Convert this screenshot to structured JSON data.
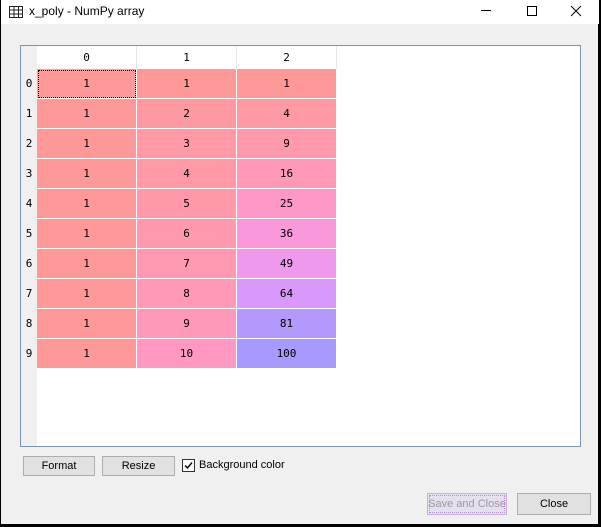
{
  "window": {
    "title": "x_poly - NumPy array"
  },
  "table": {
    "columns": [
      "0",
      "1",
      "2"
    ],
    "rows": [
      "0",
      "1",
      "2",
      "3",
      "4",
      "5",
      "6",
      "7",
      "8",
      "9"
    ],
    "cells": [
      [
        "1",
        "1",
        "1"
      ],
      [
        "1",
        "2",
        "4"
      ],
      [
        "1",
        "3",
        "9"
      ],
      [
        "1",
        "4",
        "16"
      ],
      [
        "1",
        "5",
        "25"
      ],
      [
        "1",
        "6",
        "36"
      ],
      [
        "1",
        "7",
        "49"
      ],
      [
        "1",
        "8",
        "64"
      ],
      [
        "1",
        "9",
        "81"
      ],
      [
        "1",
        "10",
        "100"
      ]
    ],
    "cell_colors": [
      [
        "#ff9999",
        "#ff9999",
        "#ff9999"
      ],
      [
        "#ff9999",
        "#ff99a1",
        "#ff99a3"
      ],
      [
        "#ff9999",
        "#ff99a3",
        "#ff99ab"
      ],
      [
        "#ff9999",
        "#ff99a6",
        "#ff99b7"
      ],
      [
        "#ff9999",
        "#ff99a9",
        "#fe99c7"
      ],
      [
        "#ff9999",
        "#ff99ad",
        "#fa99d9"
      ],
      [
        "#ff9999",
        "#ff99b1",
        "#f099ec"
      ],
      [
        "#ff9999",
        "#ff99b6",
        "#d999fa"
      ],
      [
        "#ff9999",
        "#ff99ba",
        "#b399fc"
      ],
      [
        "#ff9999",
        "#ff99c1",
        "#a799ff"
      ]
    ],
    "selected_cell": "0,0"
  },
  "controls": {
    "format_label": "Format",
    "resize_label": "Resize",
    "background_color_label": "Background color",
    "background_color_checked": true,
    "save_close_label": "Save and Close",
    "close_label": "Close"
  },
  "icons": {
    "title_icon": "table-grid-icon",
    "minimize": "minimize-icon",
    "maximize": "maximize-icon",
    "close": "close-icon",
    "checkmark": "checkmark-icon"
  }
}
